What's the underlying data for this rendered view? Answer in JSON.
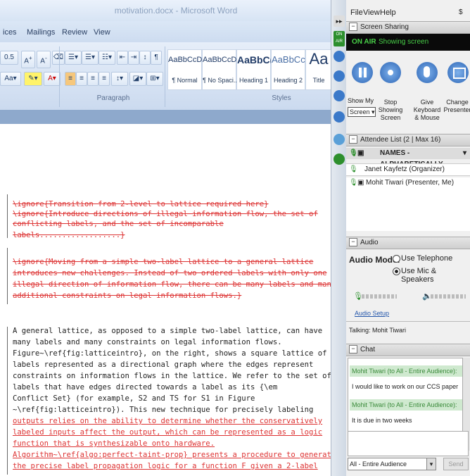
{
  "word": {
    "title": "motivation.docx - Microsoft Word",
    "tabs": [
      "ices",
      "Mailings",
      "Review",
      "View"
    ],
    "font_size": "0.5",
    "groups": [
      "Paragraph",
      "Styles"
    ],
    "styles": [
      {
        "sample": "AaBbCcDc",
        "name": "¶ Normal"
      },
      {
        "sample": "AaBbCcDc",
        "name": "¶ No Spaci..."
      },
      {
        "sample": "AaBbC(",
        "name": "Heading 1"
      },
      {
        "sample": "AaBbCc",
        "name": "Heading 2"
      },
      {
        "sample": "Aa",
        "name": "Title"
      }
    ],
    "doc_lines": [
      {
        "text": "\\ignore{Transition from 2-level to lattice required here}",
        "style": "del"
      },
      {
        "text": "\\ignore{Introduce directions of illegal information flow, the set of",
        "style": "del"
      },
      {
        "text": "conflicting labels, and the set of incomparable",
        "style": "del"
      },
      {
        "text": "labels..................}",
        "style": "del"
      },
      {
        "text": "",
        "style": "plain"
      },
      {
        "text": "\\ignore{Moving from a simple two-label lattice to a general lattice",
        "style": "del"
      },
      {
        "text": "introduces new challenges.  Instead of two ordered labels with only one",
        "style": "del"
      },
      {
        "text": "illegal direction of information flow, there can be many labels and many",
        "style": "del"
      },
      {
        "text": "additional constraints on legal information flows.}",
        "style": "del"
      },
      {
        "text": "",
        "style": "plain"
      },
      {
        "text": "A general lattice, as opposed to a simple two-label lattice, can have",
        "style": "plain"
      },
      {
        "text": "many labels and many constraints on legal information flows.",
        "style": "plain"
      },
      {
        "text": "Figure~\\ref{fig:latticeintro}, on the right, shows a square lattice of",
        "style": "plain"
      },
      {
        "text": "labels represented as a directional  graph where the edges represent",
        "style": "plain"
      },
      {
        "text": "constraints on information flows in the lattice.  We refer to the set of",
        "style": "plain"
      },
      {
        "text": "labels that have edges directed towards a label as its {\\em",
        "style": "plain"
      },
      {
        "text": "Conflict Set} (for example, S2 and TS for S1 in Figure",
        "style": "plain"
      },
      {
        "text": "~\\ref{fig:latticeintro}). This new technique for precisely labeling",
        "style": "plain"
      },
      {
        "text": "outputs relies on the ability to determine whether the conservatively",
        "style": "ins"
      },
      {
        "text": "labeled inputs affect the output, which can be represented as a logic",
        "style": "ins"
      },
      {
        "text": "function that is synthesizable onto hardware.",
        "style": "ins"
      },
      {
        "text": "Algorithm~\\ref{algo:perfect-taint-prop} presents a procedure to generate",
        "style": "ins"
      },
      {
        "text": "the precise label propagation logic for a function F given a 2-label",
        "style": "ins"
      }
    ]
  },
  "gtm": {
    "menu": [
      "File",
      "View",
      "Help"
    ],
    "screen_sharing": {
      "header": "Screen Sharing",
      "on_air": "ON AIR",
      "status": "Showing screen",
      "show_my": "Show My",
      "screen_select": "Screen",
      "stop": "Stop Showing Screen",
      "give": "Give Keyboard & Mouse",
      "change": "Change Presenter"
    },
    "attendee": {
      "header": "Attendee List",
      "count": "(2 | Max 16)",
      "sort": "NAMES - ALPHABETICALLY",
      "people": [
        "Janet Kayfetz  (Organizer)",
        "Mohit Tiwari (Presenter, Me)"
      ]
    },
    "audio": {
      "header": "Audio",
      "mode_label": "Audio Mode:",
      "opt1": "Use Telephone",
      "opt2": "Use Mic & Speakers",
      "setup": "Audio Setup",
      "talking": "Talking: Mohit Tiwari"
    },
    "chat": {
      "header": "Chat",
      "messages": [
        {
          "from": "Mohit Tiwari (to All - Entire Audience):",
          "text": "I would like to work on our CCS paper"
        },
        {
          "from": "Mohit Tiwari (to All - Entire Audience):",
          "text": "It is due in two weeks"
        }
      ],
      "audience": "All - Entire Audience",
      "send": "Send"
    }
  },
  "colors": {
    "accent_green": "#2d8f2d",
    "track_red": "#d33333",
    "ribbon_blue": "#cddcf0"
  }
}
